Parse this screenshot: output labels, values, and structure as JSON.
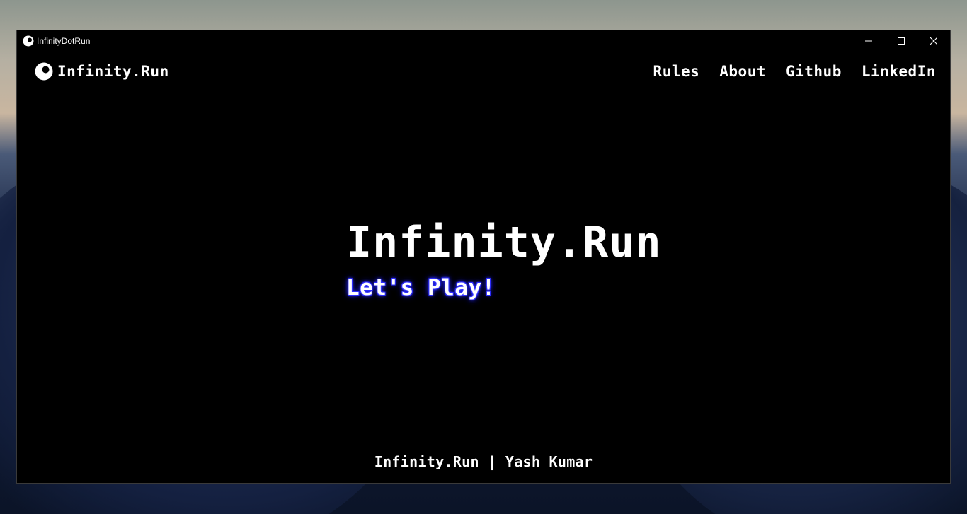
{
  "window": {
    "title": "InfinityDotRun",
    "controls": {
      "minimize_icon": "minimize-icon",
      "maximize_icon": "maximize-icon",
      "close_icon": "close-icon"
    }
  },
  "navbar": {
    "brand": "Infinity.Run",
    "brand_icon": "eye-logo-icon",
    "links": [
      {
        "label": "Rules"
      },
      {
        "label": "About"
      },
      {
        "label": "Github"
      },
      {
        "label": "LinkedIn"
      }
    ]
  },
  "hero": {
    "title": "Infinity.Run",
    "cta": "Let's Play!",
    "cta_glow_color": "#2a2aff"
  },
  "footer": {
    "text": "Infinity.Run | Yash Kumar"
  },
  "colors": {
    "background": "#000000",
    "text": "#ffffff",
    "accent": "#2a2aff"
  }
}
